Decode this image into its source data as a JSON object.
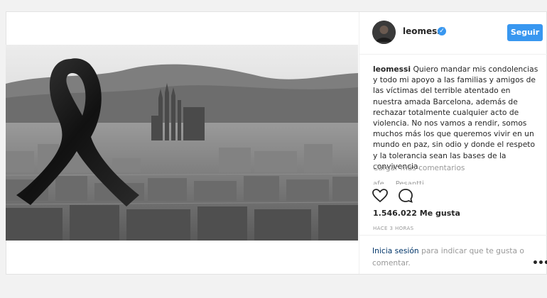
{
  "post": {
    "username": "leomessi",
    "follow_label": "Seguir",
    "verified_icon": "check-icon",
    "caption_user": "leomessi",
    "caption_text": "Quiero mandar mis condolencias y todo mi apoyo a las familias y amigos de las víctimas del terrible atentado en nuestra amada Barcelona, además de rechazar totalmente cualquier acto de violencia. No nos vamos a rendir, somos muchos más los que queremos vivir en un mundo en paz, sin odio y donde el respeto y la tolerancia sean las bases de la convivencia.",
    "load_more": "Cargar más comentarios",
    "partial_comment": "afe ... Pesantti",
    "likes": "1.546.022 Me gusta",
    "time": "HACE 3 HORAS",
    "login_link": "Inicia sesión",
    "login_rest": " para indicar que te gusta o comentar.",
    "more_label": "•••"
  },
  "colors": {
    "accent": "#3897f0",
    "link": "#003569",
    "muted": "#999999",
    "text": "#262626"
  },
  "icons": [
    "heart-icon",
    "comment-icon",
    "more-options-icon"
  ]
}
